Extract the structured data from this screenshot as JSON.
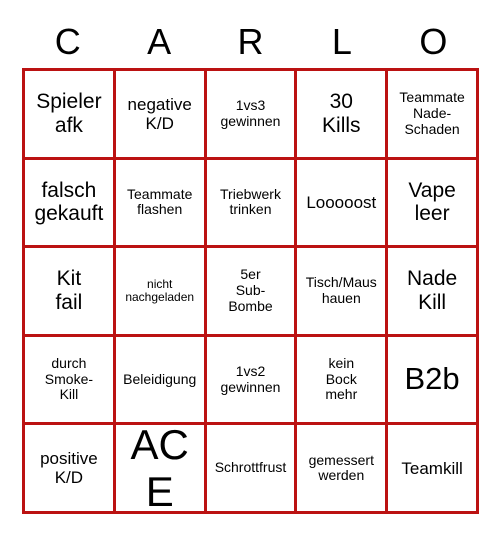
{
  "card": {
    "colors": {
      "grid_line": "#bb1212",
      "text": "#000000",
      "background": "#ffffff"
    },
    "header": {
      "letters": [
        "C",
        "A",
        "R",
        "L",
        "O"
      ]
    },
    "rows": [
      [
        {
          "text": "Spieler\nafk",
          "size": "lg"
        },
        {
          "text": "negative\nK/D",
          "size": "md"
        },
        {
          "text": "1vs3\ngewinnen",
          "size": "sm"
        },
        {
          "text": "30\nKills",
          "size": "lg"
        },
        {
          "text": "Teammate\nNade-\nSchaden",
          "size": "sm"
        }
      ],
      [
        {
          "text": "falsch\ngekauft",
          "size": "lg"
        },
        {
          "text": "Teammate\nflashen",
          "size": "sm"
        },
        {
          "text": "Triebwerk\ntrinken",
          "size": "sm"
        },
        {
          "text": "Looooost",
          "size": "md"
        },
        {
          "text": "Vape\nleer",
          "size": "lg"
        }
      ],
      [
        {
          "text": "Kit\nfail",
          "size": "lg"
        },
        {
          "text": "nicht\nnachgeladen",
          "size": "xs"
        },
        {
          "text": "5er\nSub-\nBombe",
          "size": "sm"
        },
        {
          "text": "Tisch/Maus\nhauen",
          "size": "sm"
        },
        {
          "text": "Nade\nKill",
          "size": "lg"
        }
      ],
      [
        {
          "text": "durch\nSmoke-\nKill",
          "size": "sm"
        },
        {
          "text": "Beleidigung",
          "size": "sm"
        },
        {
          "text": "1vs2\ngewinnen",
          "size": "sm"
        },
        {
          "text": "kein\nBock\nmehr",
          "size": "sm"
        },
        {
          "text": "B2b",
          "size": "xl"
        }
      ],
      [
        {
          "text": "positive\nK/D",
          "size": "md"
        },
        {
          "text": "ACE",
          "size": "xxl"
        },
        {
          "text": "Schrottfrust",
          "size": "sm"
        },
        {
          "text": "gemessert\nwerden",
          "size": "sm"
        },
        {
          "text": "Teamkill",
          "size": "md"
        }
      ]
    ]
  }
}
